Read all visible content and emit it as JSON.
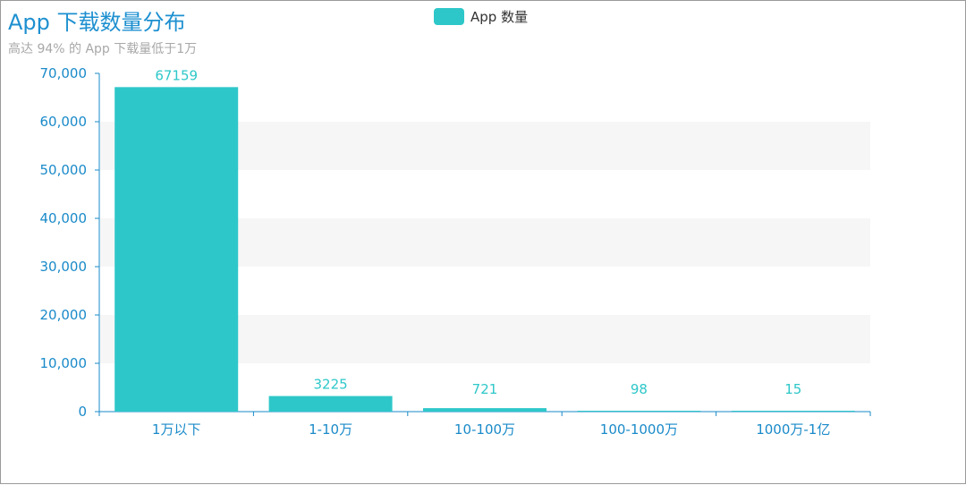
{
  "title": "App 下载数量分布",
  "subtitle": "高达 94% 的 App 下载量低于1万",
  "colors": {
    "bar": "#2ec7c9",
    "axis": "#1a8ac9",
    "title": "#1e90d0",
    "subtitle": "#a8a8a8",
    "band": "#f6f6f6"
  },
  "chart_data": {
    "type": "bar",
    "title": "App 下载数量分布",
    "subtitle": "高达 94% 的 App 下载量低于1万",
    "categories": [
      "1万以下",
      "1-10万",
      "10-100万",
      "100-1000万",
      "1000万-1亿"
    ],
    "series": [
      {
        "name": "App 数量",
        "values": [
          67159,
          3225,
          721,
          98,
          15
        ]
      }
    ],
    "ylim": [
      0,
      70000
    ],
    "yticks": [
      "0",
      "10,000",
      "20,000",
      "30,000",
      "40,000",
      "50,000",
      "60,000",
      "70,000"
    ],
    "legend": "top-center",
    "grid": false
  }
}
